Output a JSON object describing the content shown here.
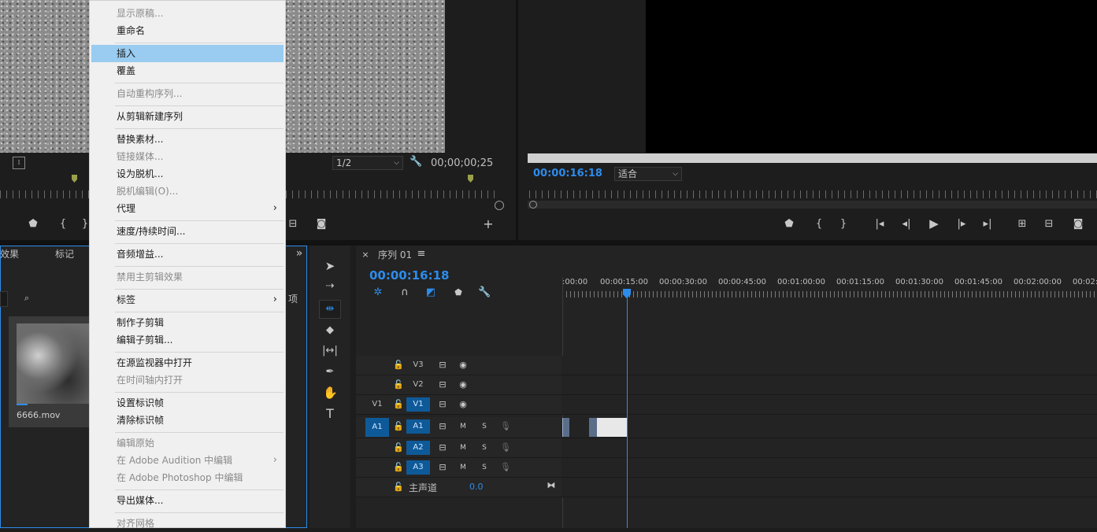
{
  "source_monitor": {
    "zoom": "1/2",
    "timecode": "00;00;00;25"
  },
  "program_monitor": {
    "timecode": "00:00:16:18",
    "fit": "适合"
  },
  "project_panel": {
    "tabs": [
      "效果",
      "标记"
    ],
    "tab_cut": "项",
    "clip_name": "6666.mov"
  },
  "timeline": {
    "sequence_name": "序列 01",
    "timecode": "00:00:16:18",
    "ruler": [
      ":00:00",
      "00:00:15:00",
      "00:00:30:00",
      "00:00:45:00",
      "00:01:00:00",
      "00:01:15:00",
      "00:01:30:00",
      "00:01:45:00",
      "00:02:00:00",
      "00:02:"
    ],
    "video_tracks": [
      "V3",
      "V2",
      "V1"
    ],
    "source_v": "V1",
    "audio_tracks": [
      "A1",
      "A2",
      "A3"
    ],
    "source_a": "A1",
    "mute": "M",
    "solo": "S",
    "master_label": "主声道",
    "master_value": "0.0"
  },
  "context_menu": {
    "items": [
      {
        "label": "显示原稿...",
        "disabled": true
      },
      {
        "label": "重命名",
        "disabled": false
      },
      {
        "label": "插入",
        "disabled": false,
        "highlighted": true
      },
      {
        "label": "覆盖",
        "disabled": false
      },
      {
        "label": "自动重构序列...",
        "disabled": true
      },
      {
        "label": "从剪辑新建序列",
        "disabled": false
      },
      {
        "label": "替换素材...",
        "disabled": false
      },
      {
        "label": "链接媒体...",
        "disabled": true
      },
      {
        "label": "设为脱机...",
        "disabled": false
      },
      {
        "label": "脱机编辑(O)...",
        "disabled": true
      },
      {
        "label": "代理",
        "disabled": false,
        "submenu": true
      },
      {
        "label": "速度/持续时间...",
        "disabled": false
      },
      {
        "label": "音频增益...",
        "disabled": false
      },
      {
        "label": "禁用主剪辑效果",
        "disabled": true
      },
      {
        "label": "标签",
        "disabled": false,
        "submenu": true
      },
      {
        "label": "制作子剪辑",
        "disabled": false
      },
      {
        "label": "编辑子剪辑...",
        "disabled": false
      },
      {
        "label": "在源监视器中打开",
        "disabled": false
      },
      {
        "label": "在时间轴内打开",
        "disabled": true
      },
      {
        "label": "设置标识帧",
        "disabled": false
      },
      {
        "label": "清除标识帧",
        "disabled": false
      },
      {
        "label": "编辑原始",
        "disabled": true
      },
      {
        "label": "在 Adobe Audition 中编辑",
        "disabled": true,
        "submenu": true
      },
      {
        "label": "在 Adobe Photoshop 中编辑",
        "disabled": true
      },
      {
        "label": "导出媒体...",
        "disabled": false
      },
      {
        "label": "对齐网格",
        "disabled": true
      }
    ]
  },
  "colors": {
    "accent_blue": "#2d8ceb",
    "track_on": "#0e5a99",
    "menu_highlight": "#99ccf0"
  }
}
